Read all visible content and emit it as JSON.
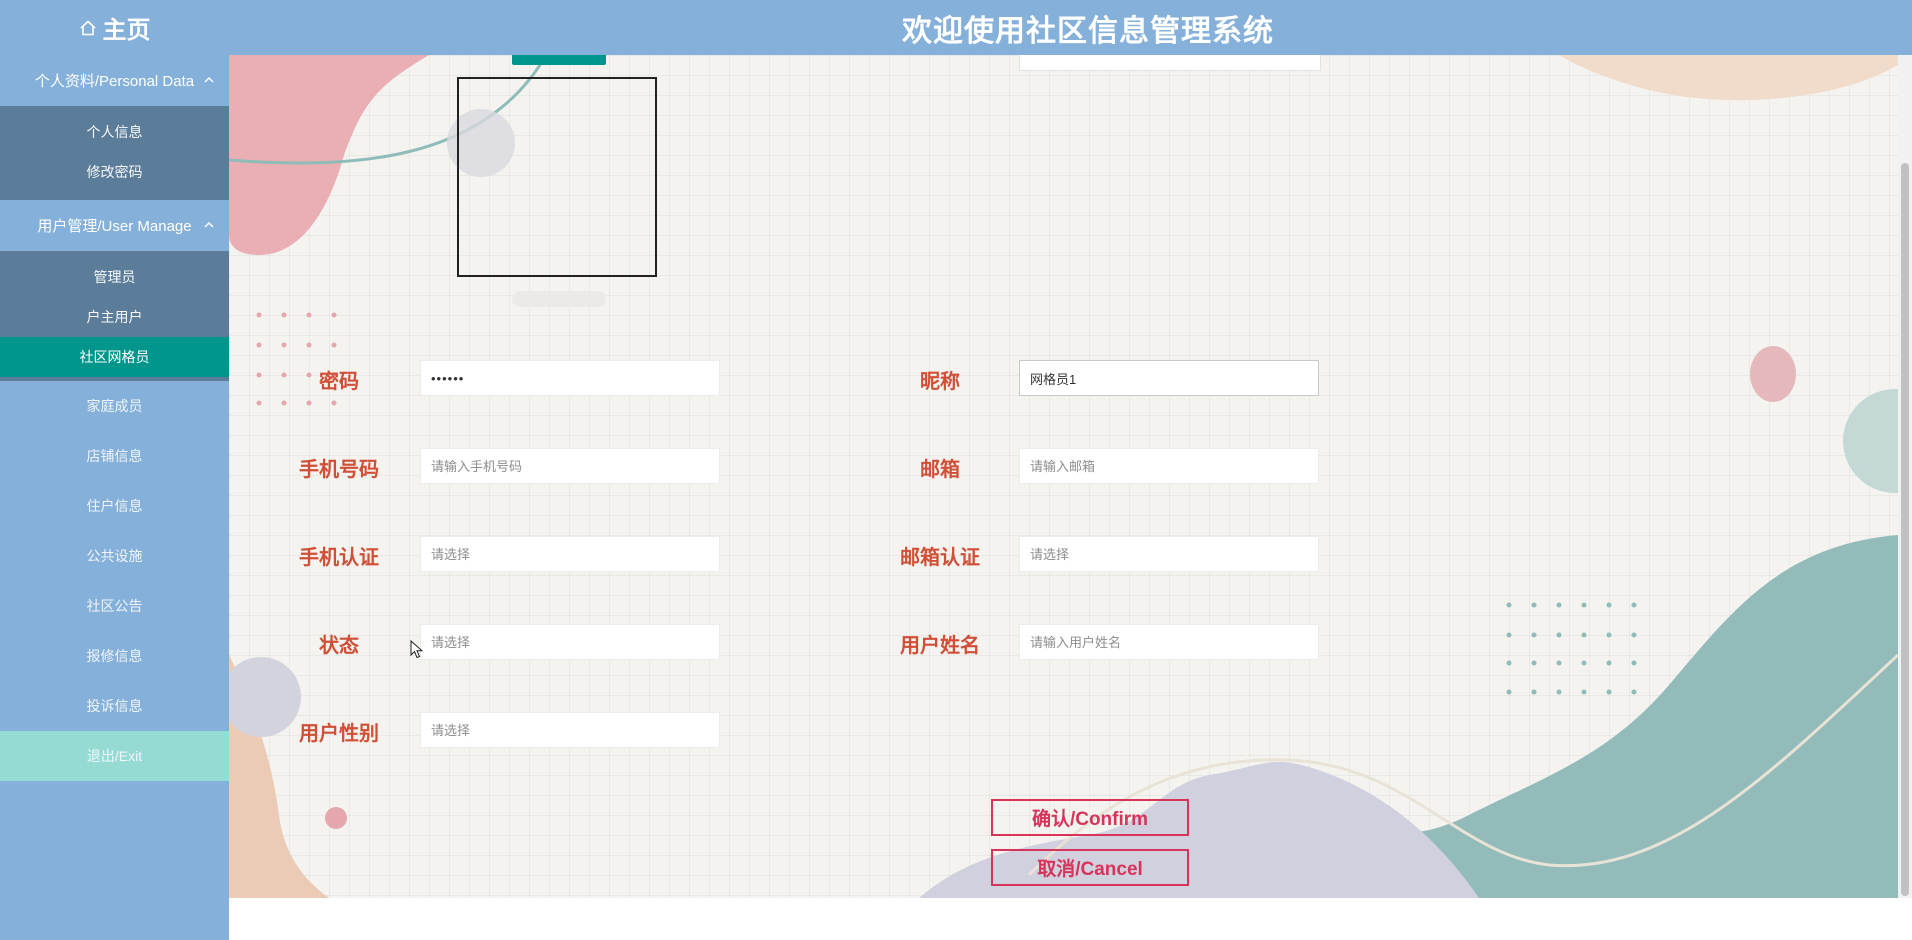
{
  "header": {
    "home_label": "主页",
    "title": "欢迎使用社区信息管理系统"
  },
  "sidebar": {
    "groups": [
      {
        "label": "个人资料/Personal Data",
        "items": [
          "个人信息",
          "修改密码"
        ]
      },
      {
        "label": "用户管理/User Manage",
        "items": [
          "管理员",
          "户主用户",
          "社区网格员"
        ]
      }
    ],
    "active_item": "社区网格员",
    "menu": [
      "家庭成员",
      "店铺信息",
      "住户信息",
      "公共设施",
      "社区公告",
      "报修信息",
      "投诉信息"
    ],
    "exit_label": "退出/Exit"
  },
  "form": {
    "password": {
      "label": "密码",
      "value": "••••••"
    },
    "nickname": {
      "label": "昵称",
      "value": "网格员1"
    },
    "phone": {
      "label": "手机号码",
      "placeholder": "请输入手机号码"
    },
    "email": {
      "label": "邮箱",
      "placeholder": "请输入邮箱"
    },
    "phone_verify": {
      "label": "手机认证",
      "placeholder": "请选择"
    },
    "email_verify": {
      "label": "邮箱认证",
      "placeholder": "请选择"
    },
    "status": {
      "label": "状态",
      "placeholder": "请选择"
    },
    "real_name": {
      "label": "用户姓名",
      "placeholder": "请输入用户姓名"
    },
    "gender": {
      "label": "用户性别",
      "placeholder": "请选择"
    }
  },
  "buttons": {
    "confirm": "确认/Confirm",
    "cancel": "取消/Cancel"
  },
  "colors": {
    "header_bg": "#84b0da",
    "submenu_bg": "#5c7d99",
    "active_bg": "#00968c",
    "exit_bg": "#98e2d4",
    "label_color": "#d04f37",
    "button_color": "#d6345a"
  },
  "icons": {
    "home": "home-icon",
    "collapse": "chevron-up-icon",
    "cursor": "mouse-pointer-icon"
  }
}
